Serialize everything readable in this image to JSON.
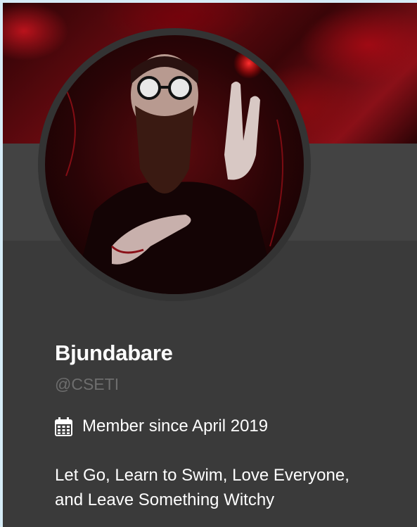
{
  "profile": {
    "display_name": "Bjundabare",
    "handle": "@CSETI",
    "member_since": "Member since April 2019",
    "bio_line1": "Let Go, Learn to Swim, Love Everyone,",
    "bio_line2": "and Leave Something Witchy"
  },
  "icons": {
    "calendar": "calendar-icon"
  },
  "colors": {
    "card_background": "#3a3a3a",
    "mid_band": "#434343",
    "banner_red": "#8a1018",
    "name_text": "#ffffff",
    "handle_text": "#6e6e6e"
  }
}
